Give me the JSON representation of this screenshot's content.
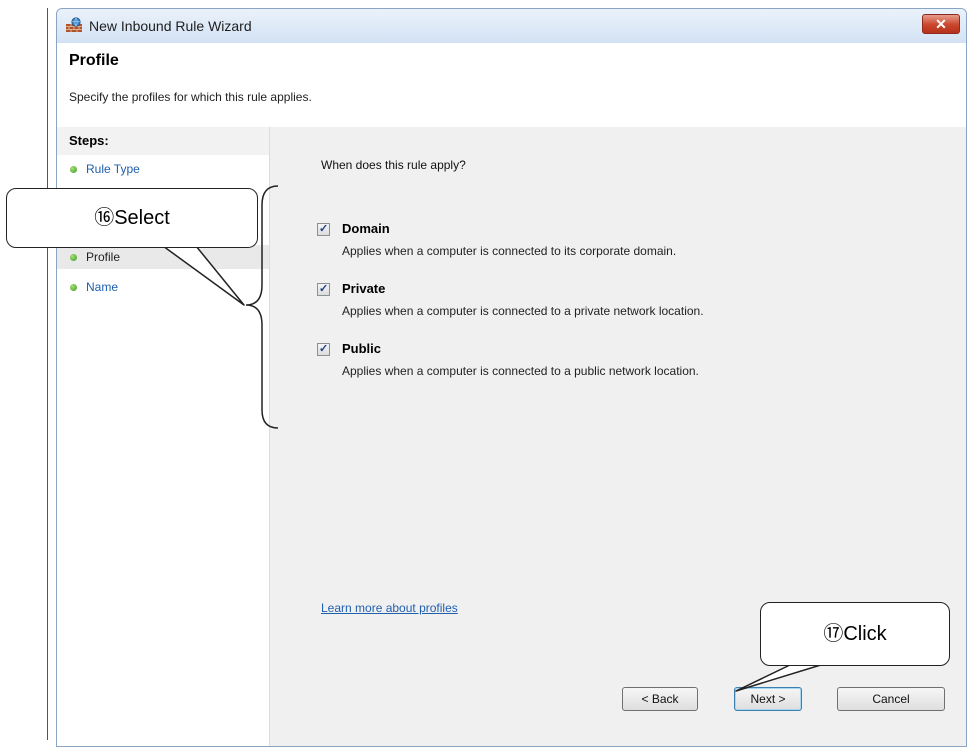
{
  "window": {
    "title": "New Inbound Rule Wizard",
    "close_label": "✕"
  },
  "header": {
    "title": "Profile",
    "subtitle": "Specify the profiles for which this rule applies."
  },
  "steps": {
    "title": "Steps:",
    "items": [
      {
        "label": "Rule Type",
        "state": "link"
      },
      {
        "label": "Profile",
        "state": "current"
      },
      {
        "label": "Name",
        "state": "link"
      }
    ]
  },
  "main": {
    "question": "When does this rule apply?",
    "options": [
      {
        "name": "Domain",
        "description": "Applies when a computer is connected to its corporate domain.",
        "checked": true
      },
      {
        "name": "Private",
        "description": "Applies when a computer is connected to a private network location.",
        "checked": true
      },
      {
        "name": "Public",
        "description": "Applies when a computer is connected to a public network location.",
        "checked": true
      }
    ],
    "learn_more": "Learn more about profiles"
  },
  "buttons": {
    "back": "< Back",
    "next": "Next >",
    "cancel": "Cancel"
  },
  "annotations": {
    "select": "⑯Select",
    "click": "⑰Click"
  },
  "icons": {
    "app": "firewall-wall-icon",
    "check": "checkmark-icon",
    "step_bullet": "green-dot-icon"
  },
  "colors": {
    "accent_link": "#1f5fae",
    "close_red": "#c9452c",
    "step_dot": "#3d9a1b"
  }
}
